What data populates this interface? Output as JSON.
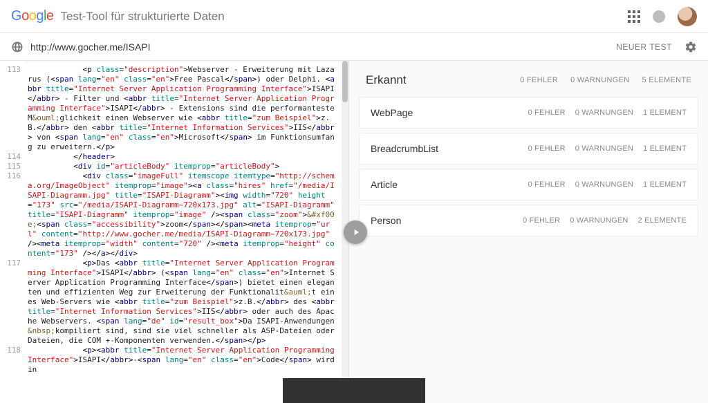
{
  "header": {
    "logo_letters": [
      "G",
      "o",
      "o",
      "g",
      "l",
      "e"
    ],
    "tool_title": "Test-Tool für strukturierte Daten"
  },
  "urlbar": {
    "url": "http://www.gocher.me/ISAPI",
    "new_test_label": "NEUER TEST"
  },
  "code_lines": [
    {
      "n": "113",
      "html": "            <span class='t-punc'>&lt;</span><span class='t-tag'>p</span> <span class='t-attr'>class</span>=<span class='t-str'>\"description\"</span><span class='t-punc'>&gt;</span>Webserver - Erweiterung mit Lazarus (<span class='t-punc'>&lt;</span><span class='t-tag'>span</span> <span class='t-attr'>lang</span>=<span class='t-str'>\"en\"</span> <span class='t-attr'>class</span>=<span class='t-str'>\"en\"</span><span class='t-punc'>&gt;</span>Free Pascal<span class='t-punc'>&lt;/</span><span class='t-tag'>span</span><span class='t-punc'>&gt;</span>) oder Delphi. <span class='t-punc'>&lt;</span><span class='t-tag'>abbr</span> <span class='t-attr'>title</span>=<span class='t-str'>\"Internet Server Application Programming Interface\"</span><span class='t-punc'>&gt;</span>ISAPI<span class='t-punc'>&lt;/</span><span class='t-tag'>abbr</span><span class='t-punc'>&gt;</span> - Filter und <span class='t-punc'>&lt;</span><span class='t-tag'>abbr</span> <span class='t-attr'>title</span>=<span class='t-str'>\"Internet Server Application Programming Interface\"</span><span class='t-punc'>&gt;</span>ISAPI<span class='t-punc'>&lt;/</span><span class='t-tag'>abbr</span><span class='t-punc'>&gt;</span> - Extensions sind die performanteste M<span class='t-ent'>&amp;ouml;</span>glichkeit einen Webserver wie <span class='t-punc'>&lt;</span><span class='t-tag'>abbr</span> <span class='t-attr'>title</span>=<span class='t-str'>\"zum Beispiel\"</span><span class='t-punc'>&gt;</span>z.B.<span class='t-punc'>&lt;/</span><span class='t-tag'>abbr</span><span class='t-punc'>&gt;</span> den <span class='t-punc'>&lt;</span><span class='t-tag'>abbr</span> <span class='t-attr'>title</span>=<span class='t-str'>\"Internet Information Services\"</span><span class='t-punc'>&gt;</span>IIS<span class='t-punc'>&lt;/</span><span class='t-tag'>abbr</span><span class='t-punc'>&gt;</span> von <span class='t-punc'>&lt;</span><span class='t-tag'>span</span> <span class='t-attr'>lang</span>=<span class='t-str'>\"en\"</span> <span class='t-attr'>class</span>=<span class='t-str'>\"en\"</span><span class='t-punc'>&gt;</span>Microsoft<span class='t-punc'>&lt;/</span><span class='t-tag'>span</span><span class='t-punc'>&gt;</span> im Funktionsumfang zu erweitern.<span class='t-punc'>&lt;/</span><span class='t-tag'>p</span><span class='t-punc'>&gt;</span>"
    },
    {
      "n": "114",
      "html": "          <span class='t-punc'>&lt;/</span><span class='t-tag'>header</span><span class='t-punc'>&gt;</span>"
    },
    {
      "n": "115",
      "html": "          <span class='t-punc'>&lt;</span><span class='t-tag'>div</span> <span class='t-attr'>id</span>=<span class='t-str'>\"articleBody\"</span> <span class='t-attr'>itemprop</span>=<span class='t-str'>\"articleBody\"</span><span class='t-punc'>&gt;</span>"
    },
    {
      "n": "116",
      "html": "            <span class='t-punc'>&lt;</span><span class='t-tag'>div</span> <span class='t-attr'>class</span>=<span class='t-str'>\"imageFull\"</span> <span class='t-attr'>itemscope</span> <span class='t-attr'>itemtype</span>=<span class='t-str'>\"http://schema.org/ImageObject\"</span> <span class='t-attr'>itemprop</span>=<span class='t-str'>\"image\"</span><span class='t-punc'>&gt;&lt;</span><span class='t-tag'>a</span> <span class='t-attr'>class</span>=<span class='t-str'>\"hires\"</span> <span class='t-attr'>href</span>=<span class='t-str'>\"/media/ISAPI-Diagramm.jpg\"</span> <span class='t-attr'>title</span>=<span class='t-str'>\"ISAPI-Diagramm\"</span><span class='t-punc'>&gt;&lt;</span><span class='t-tag'>img</span> <span class='t-attr'>width</span>=<span class='t-str'>\"720\"</span> <span class='t-attr'>height</span>=<span class='t-str'>\"173\"</span> <span class='t-attr'>src</span>=<span class='t-str'>\"/media/ISAPI-Diagramm~720x173.jpg\"</span> <span class='t-attr'>alt</span>=<span class='t-str'>\"ISAPI-Diagramm\"</span> <span class='t-attr'>title</span>=<span class='t-str'>\"ISAPI-Diagramm\"</span> <span class='t-attr'>itemprop</span>=<span class='t-str'>\"image\"</span> <span class='t-punc'>/&gt;&lt;</span><span class='t-tag'>span</span> <span class='t-attr'>class</span>=<span class='t-str'>\"zoom\"</span><span class='t-punc'>&gt;</span><span class='t-ent'>&amp;#xf00e;</span><span class='t-punc'>&lt;</span><span class='t-tag'>span</span> <span class='t-attr'>class</span>=<span class='t-str'>\"accessibility\"</span><span class='t-punc'>&gt;</span>zoom<span class='t-punc'>&lt;/</span><span class='t-tag'>span</span><span class='t-punc'>&gt;&lt;/</span><span class='t-tag'>span</span><span class='t-punc'>&gt;&lt;</span><span class='t-tag'>meta</span> <span class='t-attr'>itemprop</span>=<span class='t-str'>\"url\"</span> <span class='t-attr'>content</span>=<span class='t-str'>\"http://www.gocher.me/media/ISAPI-Diagramm~720x173.jpg\"</span> <span class='t-punc'>/&gt;&lt;</span><span class='t-tag'>meta</span> <span class='t-attr'>itemprop</span>=<span class='t-str'>\"width\"</span> <span class='t-attr'>content</span>=<span class='t-str'>\"720\"</span> <span class='t-punc'>/&gt;&lt;</span><span class='t-tag'>meta</span> <span class='t-attr'>itemprop</span>=<span class='t-str'>\"height\"</span> <span class='t-attr'>content</span>=<span class='t-str'>\"173\"</span> <span class='t-punc'>/&gt;&lt;/</span><span class='t-tag'>a</span><span class='t-punc'>&gt;&lt;/</span><span class='t-tag'>div</span><span class='t-punc'>&gt;</span>"
    },
    {
      "n": "117",
      "html": "            <span class='t-punc'>&lt;</span><span class='t-tag'>p</span><span class='t-punc'>&gt;</span>Das <span class='t-punc'>&lt;</span><span class='t-tag'>abbr</span> <span class='t-attr'>title</span>=<span class='t-str'>\"Internet Server Application Programming Interface\"</span><span class='t-punc'>&gt;</span>ISAPI<span class='t-punc'>&lt;/</span><span class='t-tag'>abbr</span><span class='t-punc'>&gt;</span> (<span class='t-punc'>&lt;</span><span class='t-tag'>span</span> <span class='t-attr'>lang</span>=<span class='t-str'>\"en\"</span> <span class='t-attr'>class</span>=<span class='t-str'>\"en\"</span><span class='t-punc'>&gt;</span>Internet Server Application Programming Interface<span class='t-punc'>&lt;/</span><span class='t-tag'>span</span><span class='t-punc'>&gt;</span>) bietet einen eleganten und effizienten Weg zur Erweiterung der Funktionalit<span class='t-ent'>&amp;auml;</span>t eines Web-Servers wie <span class='t-punc'>&lt;</span><span class='t-tag'>abbr</span> <span class='t-attr'>title</span>=<span class='t-str'>\"zum Beispiel\"</span><span class='t-punc'>&gt;</span>z.B.<span class='t-punc'>&lt;/</span><span class='t-tag'>abbr</span><span class='t-punc'>&gt;</span> des <span class='t-punc'>&lt;</span><span class='t-tag'>abbr</span> <span class='t-attr'>title</span>=<span class='t-str'>\"Internet Information Services\"</span><span class='t-punc'>&gt;</span>IIS<span class='t-punc'>&lt;/</span><span class='t-tag'>abbr</span><span class='t-punc'>&gt;</span> oder auch des Apache Webservers. <span class='t-punc'>&lt;</span><span class='t-tag'>span</span> <span class='t-attr'>lang</span>=<span class='t-str'>\"de\"</span> <span class='t-attr'>id</span>=<span class='t-str'>\"result_box\"</span><span class='t-punc'>&gt;</span>Da ISAPI-Anwendungen<span class='t-ent'>&amp;nbsp;</span>kompiliert sind, sind sie viel schneller als ASP-Dateien oder Dateien, die COM +-Komponenten verwenden.<span class='t-punc'>&lt;/</span><span class='t-tag'>span</span><span class='t-punc'>&gt;&lt;/</span><span class='t-tag'>p</span><span class='t-punc'>&gt;</span>"
    },
    {
      "n": "118",
      "html": "            <span class='t-punc'>&lt;</span><span class='t-tag'>p</span><span class='t-punc'>&gt;&lt;</span><span class='t-tag'>abbr</span> <span class='t-attr'>title</span>=<span class='t-str'>\"Internet Server Application Programming Interface\"</span><span class='t-punc'>&gt;</span>ISAPI<span class='t-punc'>&lt;/</span><span class='t-tag'>abbr</span><span class='t-punc'>&gt;</span>-<span class='t-punc'>&lt;</span><span class='t-tag'>span</span> <span class='t-attr'>lang</span>=<span class='t-str'>\"en\"</span> <span class='t-attr'>class</span>=<span class='t-str'>\"en\"</span><span class='t-punc'>&gt;</span>Code<span class='t-punc'>&lt;/</span><span class='t-tag'>span</span><span class='t-punc'>&gt;</span> wird in "
    }
  ],
  "results": {
    "title": "Erkannt",
    "summary": {
      "errors": "0 FEHLER",
      "warnings": "0 WARNUNGEN",
      "elements": "5 ELEMENTE"
    },
    "items": [
      {
        "name": "WebPage",
        "errors": "0 FEHLER",
        "warnings": "0 WARNUNGEN",
        "elements": "1 ELEMENT"
      },
      {
        "name": "BreadcrumbList",
        "errors": "0 FEHLER",
        "warnings": "0 WARNUNGEN",
        "elements": "1 ELEMENT"
      },
      {
        "name": "Article",
        "errors": "0 FEHLER",
        "warnings": "0 WARNUNGEN",
        "elements": "1 ELEMENT"
      },
      {
        "name": "Person",
        "errors": "0 FEHLER",
        "warnings": "0 WARNUNGEN",
        "elements": "2 ELEMENTE"
      }
    ]
  }
}
